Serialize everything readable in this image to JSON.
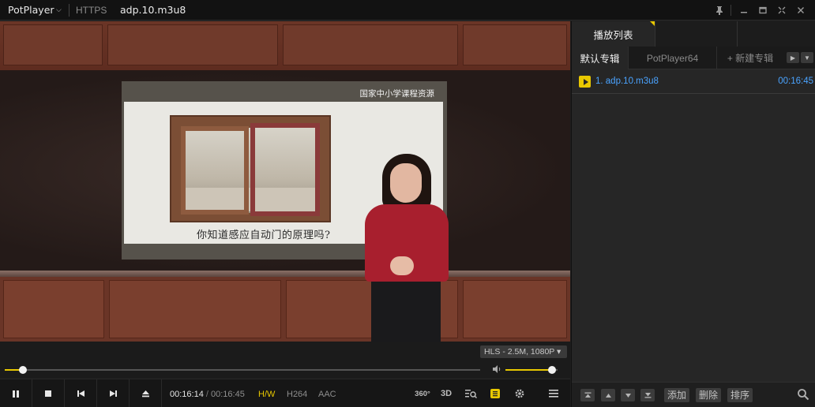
{
  "titlebar": {
    "app_name": "PotPlayer",
    "app_menu_caret": "⌵",
    "protocol": "HTTPS",
    "file_name": "adp.10.m3u8",
    "buttons": [
      "pin-icon",
      "minimize-icon",
      "maximize-icon",
      "fullscreen-icon",
      "close-icon"
    ]
  },
  "video": {
    "slide_header": "国家中小学课程资源",
    "slide_caption": "你知道感应自动门的原理吗?",
    "stream_info": "HLS - 2.5M, 1080P ▾"
  },
  "seek": {
    "progress": 0.0375,
    "volume": 0.9
  },
  "controls": {
    "current_time": "00:16:14",
    "separator": "/",
    "duration": "00:16:45",
    "hw_label": "H/W",
    "video_codec": "H264",
    "audio_codec": "AAC",
    "tool_360": "360°",
    "tool_3d": "3D",
    "accent_color": "#e8c800"
  },
  "playlist": {
    "main_tab": "播放列表",
    "sub_tabs": [
      "默认专辑",
      "PotPlayer64",
      "+ 新建专辑"
    ],
    "items": [
      {
        "title": "1. adp.10.m3u8",
        "duration": "00:16:45"
      }
    ],
    "bottom_buttons": [
      "添加",
      "删除",
      "排序"
    ]
  }
}
